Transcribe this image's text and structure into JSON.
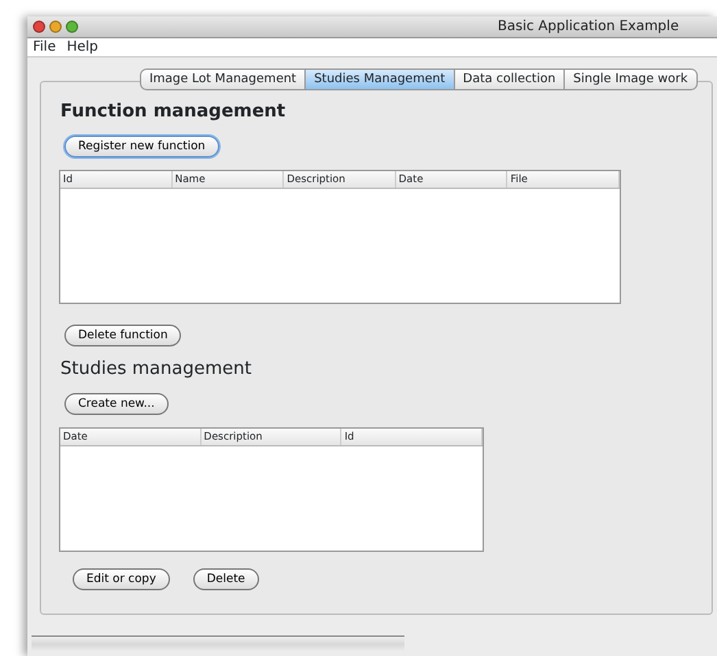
{
  "window": {
    "title": "Basic Application Example"
  },
  "menu": [
    "File",
    "Help"
  ],
  "tabs": [
    {
      "label": "Image Lot Management",
      "selected": false
    },
    {
      "label": "Studies Management",
      "selected": true
    },
    {
      "label": "Data collection",
      "selected": false
    },
    {
      "label": "Single Image work",
      "selected": false
    }
  ],
  "function_management": {
    "title": "Function management",
    "register_button": {
      "label": "Register new function",
      "focused": true
    },
    "table": {
      "columns": [
        "Id",
        "Name",
        "Description",
        "Date",
        "File"
      ]
    },
    "delete_button": {
      "label": "Delete function",
      "focused": false
    }
  },
  "studies_management": {
    "title": "Studies management",
    "create_button": {
      "label": "Create new...",
      "focused": false
    },
    "table": {
      "columns": [
        "Date",
        "Description",
        "Id"
      ]
    },
    "buttons": [
      {
        "label": "Edit or copy",
        "focused": false
      },
      {
        "label": "Delete",
        "focused": false
      }
    ]
  }
}
